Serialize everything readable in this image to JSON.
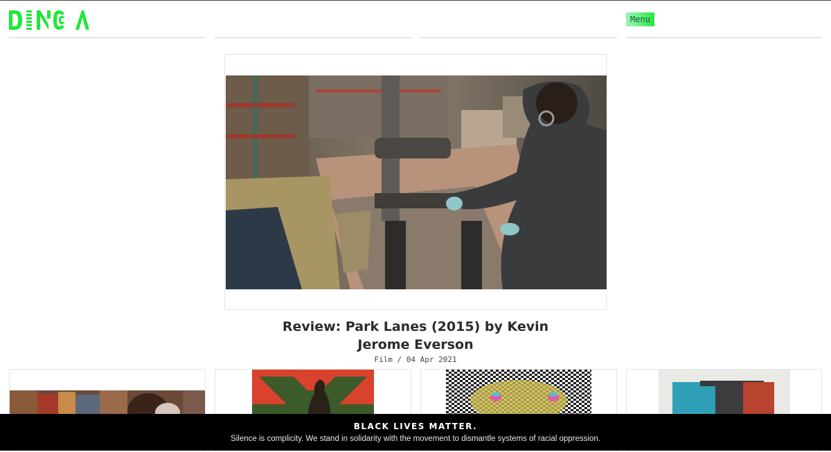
{
  "header": {
    "logo_text": "DINCA",
    "menu_label": "Menu"
  },
  "feature": {
    "title": "Review: Park Lanes (2015) by Kevin Jerome Everson",
    "category": "Film",
    "date": "04 Apr 2021",
    "meta_separator": " / "
  },
  "banner": {
    "title": "BLACK LIVES MATTER.",
    "text": "Silence is complicity. We stand in solidarity with the movement to dismantle systems of racial oppression."
  },
  "colors": {
    "brand_green": "#1ee83a",
    "banner_bg": "#000000",
    "menu_text": "#1f5a39"
  }
}
